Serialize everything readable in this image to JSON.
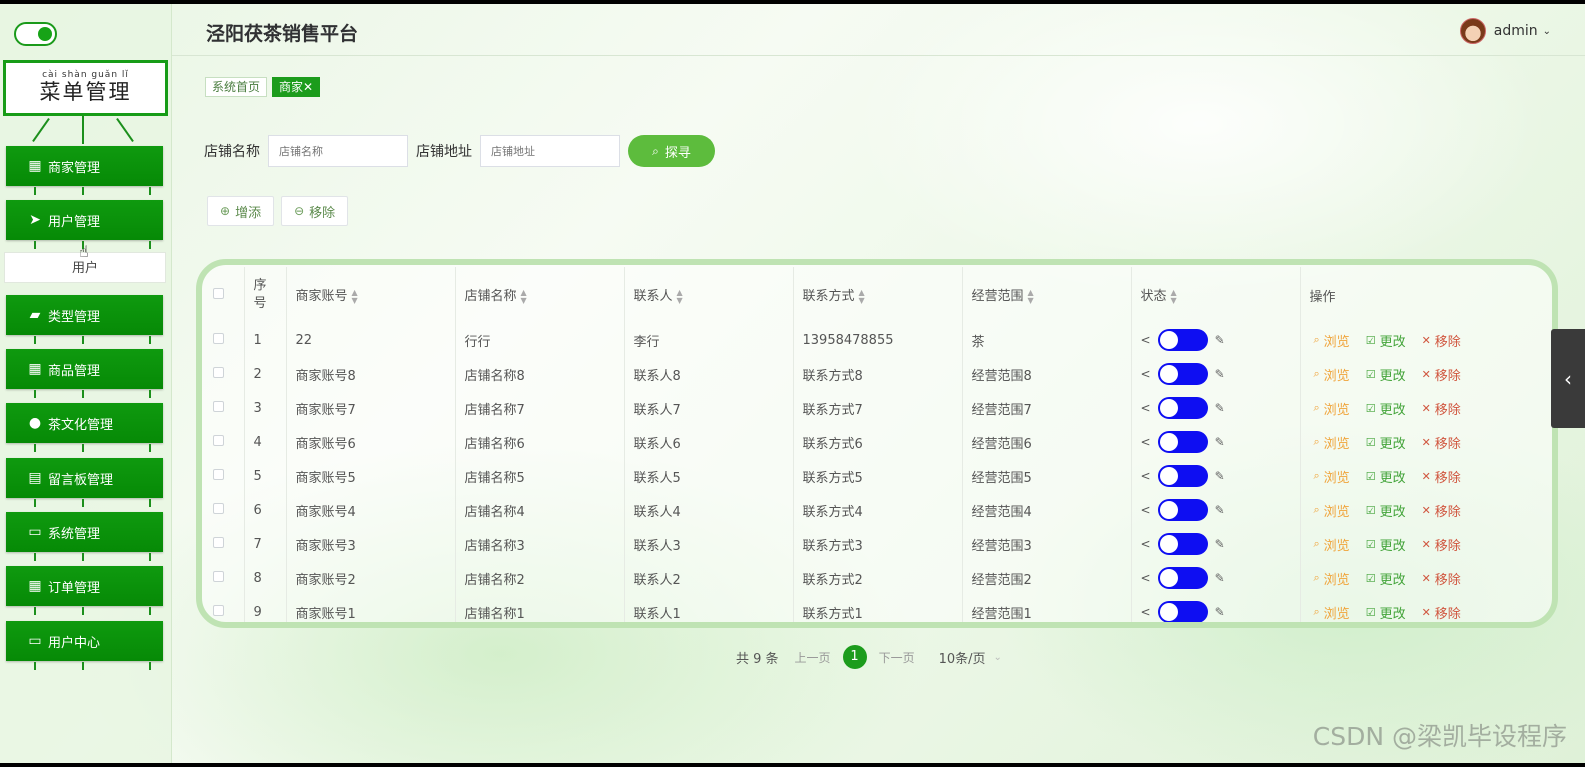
{
  "app": {
    "title": "泾阳茯茶销售平台"
  },
  "user": {
    "name": "admin"
  },
  "sidebar": {
    "menu_title_pinyin": "cài shàn guǎn lǐ",
    "menu_title": "菜单管理",
    "items": [
      {
        "label": "商家管理",
        "icon": "grid-icon"
      },
      {
        "label": "用户管理",
        "icon": "paper-plane-icon"
      },
      {
        "label": "类型管理",
        "icon": "wallet-icon"
      },
      {
        "label": "商品管理",
        "icon": "grid-icon"
      },
      {
        "label": "茶文化管理",
        "icon": "lightbulb-icon"
      },
      {
        "label": "留言板管理",
        "icon": "printer-icon"
      },
      {
        "label": "系统管理",
        "icon": "monitor-icon"
      },
      {
        "label": "订单管理",
        "icon": "grid-icon"
      },
      {
        "label": "用户中心",
        "icon": "card-icon"
      }
    ],
    "sub_item": "用户"
  },
  "breadcrumb": {
    "home": "系统首页",
    "current": "商家✕"
  },
  "search": {
    "shop_name_label": "店铺名称",
    "shop_name_placeholder": "店铺名称",
    "shop_addr_label": "店铺地址",
    "shop_addr_placeholder": "店铺地址",
    "button": "探寻"
  },
  "actions": {
    "add": "增添",
    "remove": "移除"
  },
  "table": {
    "headers": {
      "index": "序号",
      "account": "商家账号",
      "shop": "店铺名称",
      "contact": "联系人",
      "phone": "联系方式",
      "scope": "经营范围",
      "status": "状态",
      "ops": "操作"
    },
    "op_labels": {
      "view": "浏览",
      "edit": "更改",
      "delete": "移除"
    },
    "rows": [
      {
        "idx": "1",
        "account": "22",
        "shop": "行行",
        "contact": "李行",
        "phone": "13958478855",
        "scope": "茶"
      },
      {
        "idx": "2",
        "account": "商家账号8",
        "shop": "店铺名称8",
        "contact": "联系人8",
        "phone": "联系方式8",
        "scope": "经营范围8"
      },
      {
        "idx": "3",
        "account": "商家账号7",
        "shop": "店铺名称7",
        "contact": "联系人7",
        "phone": "联系方式7",
        "scope": "经营范围7"
      },
      {
        "idx": "4",
        "account": "商家账号6",
        "shop": "店铺名称6",
        "contact": "联系人6",
        "phone": "联系方式6",
        "scope": "经营范围6"
      },
      {
        "idx": "5",
        "account": "商家账号5",
        "shop": "店铺名称5",
        "contact": "联系人5",
        "phone": "联系方式5",
        "scope": "经营范围5"
      },
      {
        "idx": "6",
        "account": "商家账号4",
        "shop": "店铺名称4",
        "contact": "联系人4",
        "phone": "联系方式4",
        "scope": "经营范围4"
      },
      {
        "idx": "7",
        "account": "商家账号3",
        "shop": "店铺名称3",
        "contact": "联系人3",
        "phone": "联系方式3",
        "scope": "经营范围3"
      },
      {
        "idx": "8",
        "account": "商家账号2",
        "shop": "店铺名称2",
        "contact": "联系人2",
        "phone": "联系方式2",
        "scope": "经营范围2"
      },
      {
        "idx": "9",
        "account": "商家账号1",
        "shop": "店铺名称1",
        "contact": "联系人1",
        "phone": "联系方式1",
        "scope": "经营范围1"
      }
    ]
  },
  "pagination": {
    "total": "共 9 条",
    "prev": "上一页",
    "page": "1",
    "next": "下一页",
    "size": "10条/页"
  },
  "watermark": "CSDN @梁凯毕设程序",
  "colors": {
    "accent": "#1c9c1c",
    "switch_on": "#0e0ef2",
    "view": "#f0a43b",
    "edit": "#43a43a",
    "delete": "#d0553e"
  }
}
